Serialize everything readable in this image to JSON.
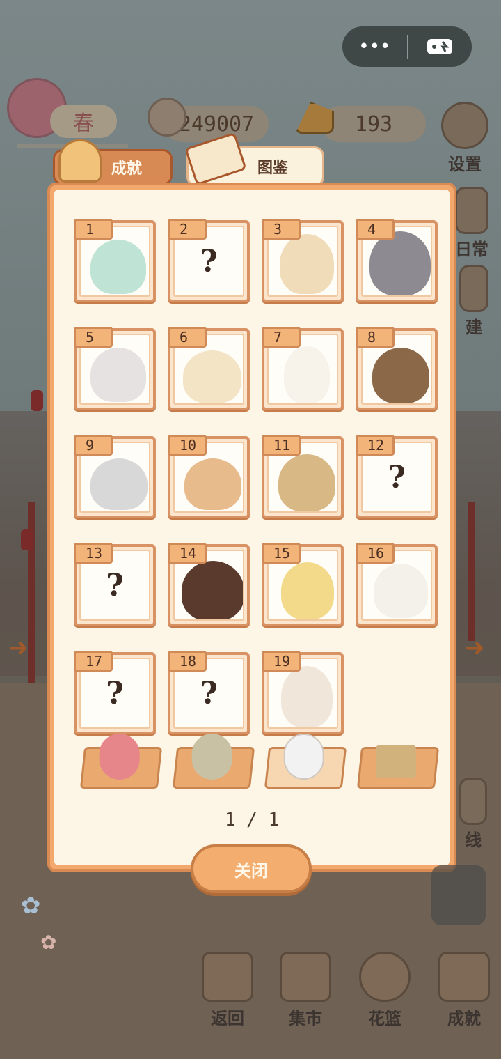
{
  "capsule": {
    "menu_icon": "more-dots-icon",
    "game_icon": "gamepad-icon"
  },
  "hud": {
    "season_label": "春",
    "fish_count": "249007",
    "cheese_count": "193"
  },
  "side_buttons": {
    "settings": "设置",
    "daily": "日常",
    "build": "建",
    "route": "线"
  },
  "tabs": {
    "achievements": "成就",
    "collection": "图鉴"
  },
  "cards": [
    {
      "num": "1",
      "state": "known"
    },
    {
      "num": "2",
      "state": "unknown",
      "mark": "?"
    },
    {
      "num": "3",
      "state": "known"
    },
    {
      "num": "4",
      "state": "silhouette"
    },
    {
      "num": "5",
      "state": "known"
    },
    {
      "num": "6",
      "state": "known"
    },
    {
      "num": "7",
      "state": "known"
    },
    {
      "num": "8",
      "state": "known"
    },
    {
      "num": "9",
      "state": "known"
    },
    {
      "num": "10",
      "state": "known"
    },
    {
      "num": "11",
      "state": "known"
    },
    {
      "num": "12",
      "state": "unknown",
      "mark": "?"
    },
    {
      "num": "13",
      "state": "unknown",
      "mark": "?"
    },
    {
      "num": "14",
      "state": "known"
    },
    {
      "num": "15",
      "state": "known"
    },
    {
      "num": "16",
      "state": "known"
    },
    {
      "num": "17",
      "state": "unknown",
      "mark": "?"
    },
    {
      "num": "18",
      "state": "unknown",
      "mark": "?"
    },
    {
      "num": "19",
      "state": "known"
    }
  ],
  "pager": "1 / 1",
  "close_label": "关闭",
  "nav": {
    "back": "返回",
    "market": "集市",
    "basket": "花篮",
    "achievements": "成就"
  },
  "colors": {
    "panel": "#f3a86d",
    "panel_inner": "#fdf6e6",
    "accent": "#d88a54"
  }
}
